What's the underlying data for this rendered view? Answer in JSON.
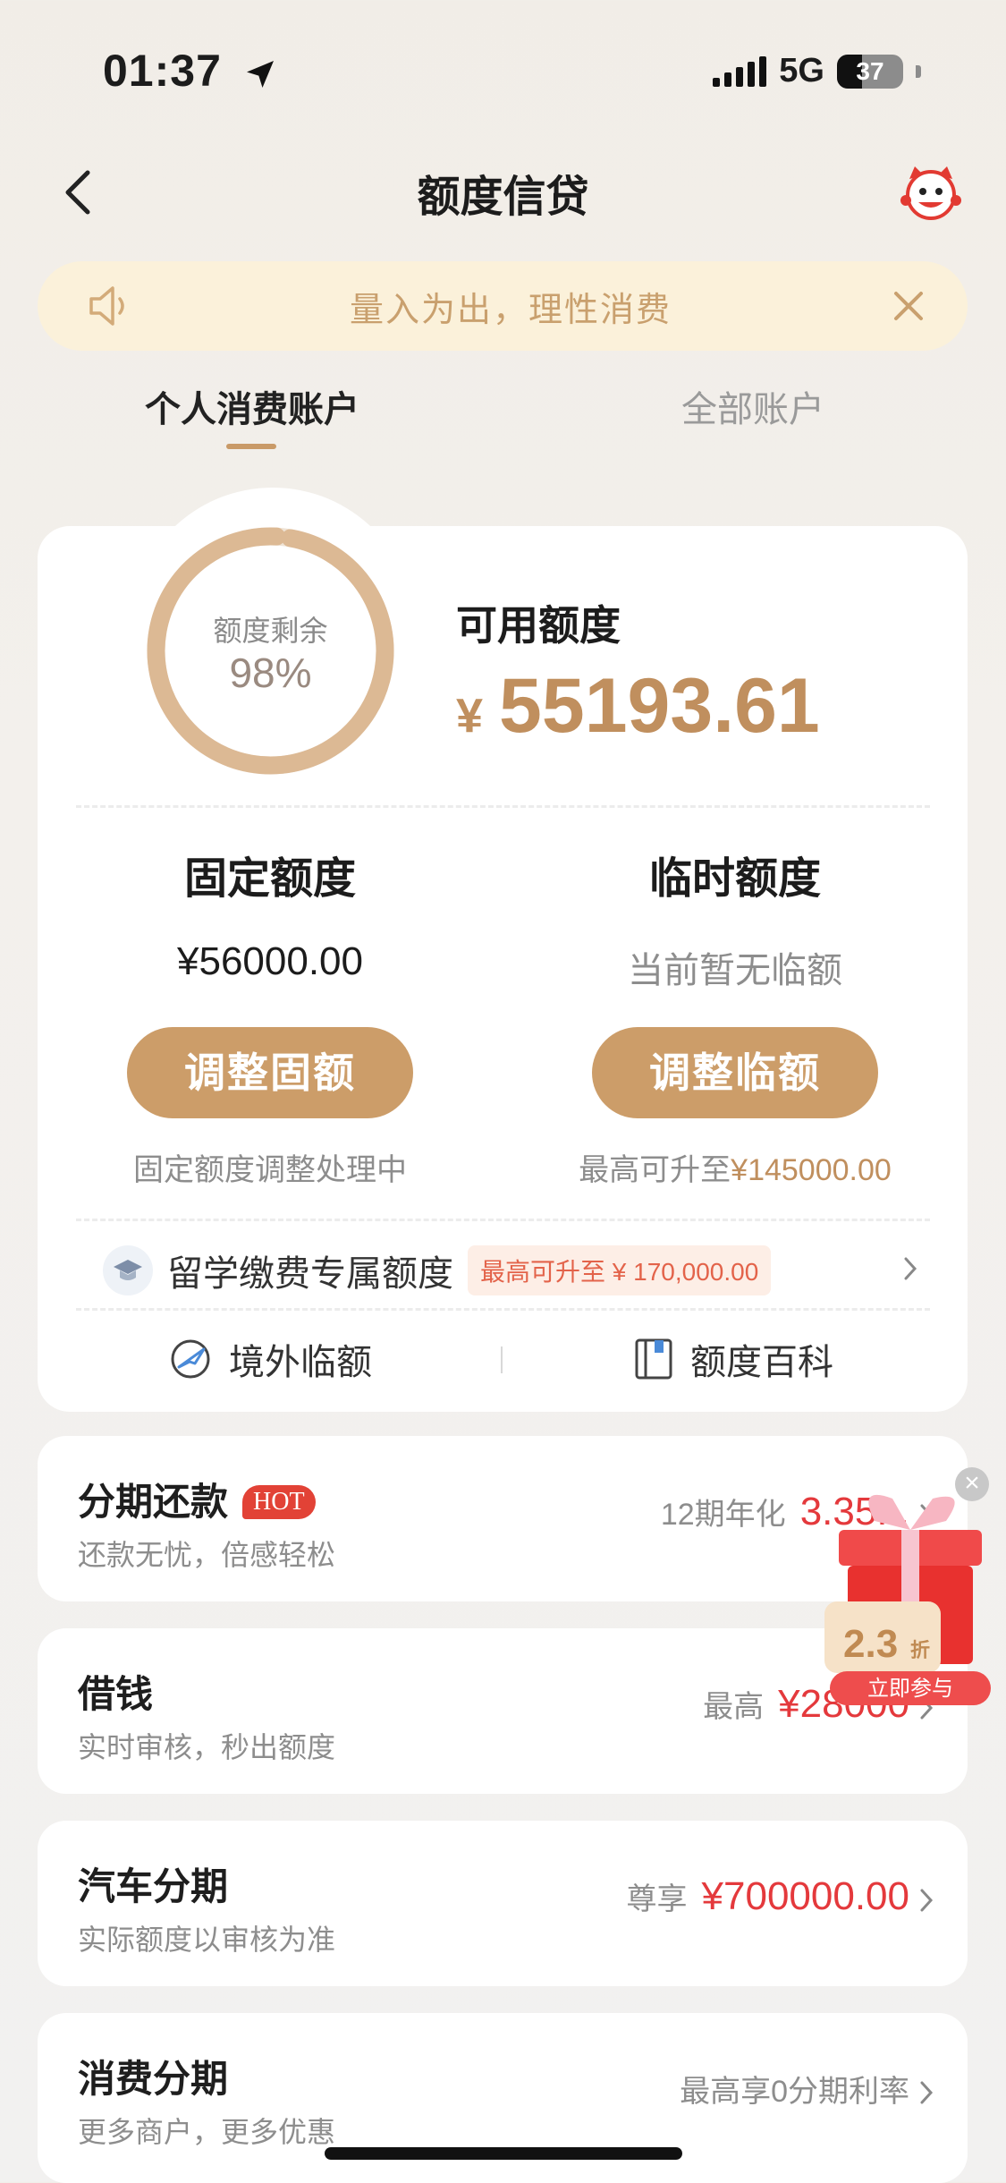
{
  "status_bar": {
    "time": "01:37",
    "network": "5G",
    "battery": "37"
  },
  "nav": {
    "title": "额度信贷"
  },
  "notice": {
    "text": "量入为出，理性消费"
  },
  "tabs": [
    {
      "label": "个人消费账户"
    },
    {
      "label": "全部账户"
    }
  ],
  "credit": {
    "ring_label": "额度剩余",
    "ring_percent": "98%",
    "ring_fraction": 0.98,
    "available_label": "可用额度",
    "currency": "¥",
    "available_amount": "55193.61",
    "fixed": {
      "title": "固定额度",
      "value": "¥56000.00",
      "button": "调整固额",
      "note": "固定额度调整处理中"
    },
    "temporary": {
      "title": "临时额度",
      "value": "当前暂无临额",
      "button": "调整临额",
      "note_prefix": "最高可升至",
      "note_amount": "¥145000.00"
    },
    "study": {
      "label": "留学缴费专属额度",
      "badge": "最高可升至 ¥ 170,000.00"
    },
    "links": [
      {
        "label": "境外临额"
      },
      {
        "label": "额度百科"
      }
    ]
  },
  "features": [
    {
      "title": "分期还款",
      "badge": "HOT",
      "subtitle": "还款无忧，倍感轻松",
      "right_label": "12期年化",
      "right_value": "3.35..."
    },
    {
      "title": "借钱",
      "subtitle": "实时审核，秒出额度",
      "right_label": "最高",
      "right_value": "¥28000"
    },
    {
      "title": "汽车分期",
      "subtitle": "实际额度以审核为准",
      "right_label": "尊享",
      "right_value": "¥700000.00"
    },
    {
      "title": "消费分期",
      "subtitle": "更多商户，更多优惠",
      "right_label": "最高享0分期利率",
      "right_value": ""
    }
  ],
  "gift_popup": {
    "discount": "2.3",
    "discount_unit": "折",
    "cta": "立即参与"
  },
  "colors": {
    "gold": "#cc9d69",
    "red": "#e4393c",
    "notice_bg": "#fbf1da"
  }
}
